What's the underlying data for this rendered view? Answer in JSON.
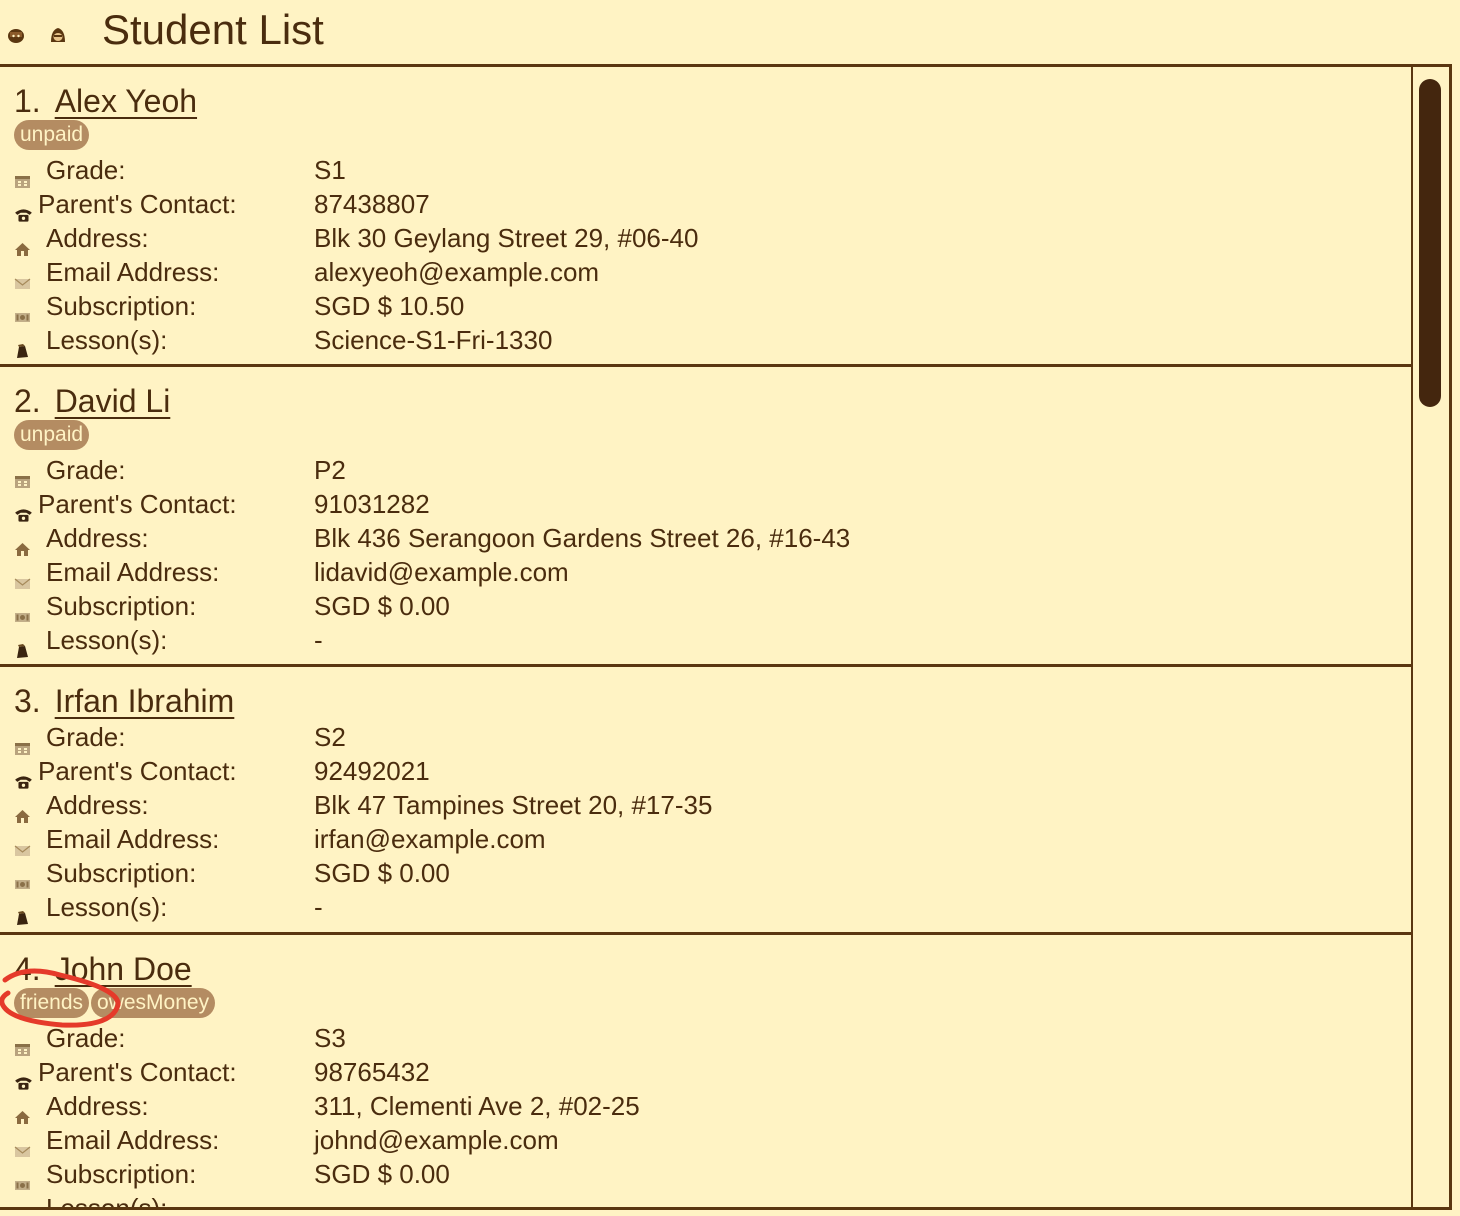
{
  "header": {
    "title": "Student List",
    "icons": [
      "student-icon",
      "teacher-icon"
    ]
  },
  "field_labels": {
    "grade": "Grade:",
    "phone": "Parent's Contact:",
    "address": "Address:",
    "email": "Email Address:",
    "subscription": "Subscription:",
    "lessons": "Lesson(s):"
  },
  "field_icons": {
    "grade": "calendar-icon",
    "phone": "telephone-icon",
    "address": "house-icon",
    "email": "envelope-icon",
    "subscription": "money-icon",
    "lessons": "book-icon"
  },
  "students": [
    {
      "index": "1.",
      "name": "Alex Yeoh",
      "tags": [
        "unpaid"
      ],
      "grade": "S1",
      "phone": "87438807",
      "address": "Blk 30 Geylang Street 29, #06-40",
      "email": "alexyeoh@example.com",
      "subscription": "SGD $ 10.50",
      "lessons": "Science-S1-Fri-1330"
    },
    {
      "index": "2.",
      "name": "David Li",
      "tags": [
        "unpaid"
      ],
      "grade": "P2",
      "phone": "91031282",
      "address": "Blk 436 Serangoon Gardens Street 26, #16-43",
      "email": "lidavid@example.com",
      "subscription": "SGD $ 0.00",
      "lessons": "-"
    },
    {
      "index": "3.",
      "name": "Irfan Ibrahim",
      "tags": [],
      "grade": "S2",
      "phone": "92492021",
      "address": "Blk 47 Tampines Street 20, #17-35",
      "email": "irfan@example.com",
      "subscription": "SGD $ 0.00",
      "lessons": "-"
    },
    {
      "index": "4.",
      "name": "John Doe",
      "tags": [
        "friends",
        "owesMoney"
      ],
      "grade": "S3",
      "phone": "98765432",
      "address": "311, Clementi Ave 2, #02-25",
      "email": "johnd@example.com",
      "subscription": "SGD $ 0.00",
      "lessons": "-"
    }
  ],
  "colors": {
    "background": "#fff3c4",
    "text": "#4a2c0e",
    "border": "#5a3610",
    "tag_bg": "#b48c62",
    "scroll_thumb": "#44260e",
    "annotation": "#e53a2a"
  }
}
